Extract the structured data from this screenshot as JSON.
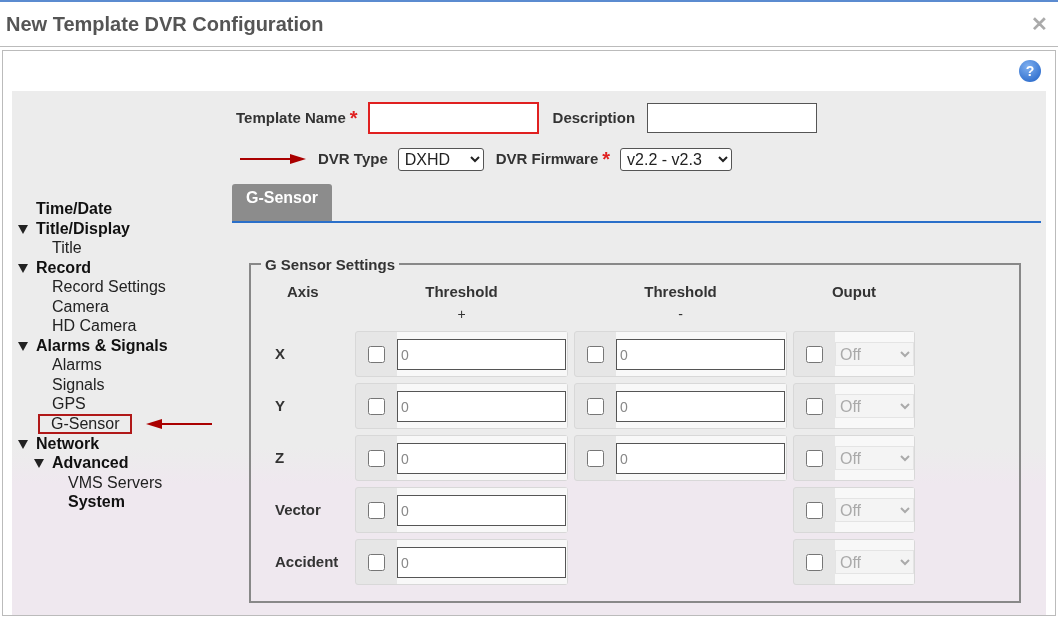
{
  "window": {
    "title": "New Template DVR Configuration",
    "close": "✕",
    "help": "?"
  },
  "form": {
    "template_name": {
      "label": "Template Name",
      "required": "*"
    },
    "description": {
      "label": "Description"
    },
    "dvr_type": {
      "label": "DVR Type",
      "value": "DXHD"
    },
    "dvr_firmware": {
      "label": "DVR Firmware",
      "required": "*",
      "value": "v2.2 - v2.3"
    }
  },
  "sidebar": {
    "items": [
      {
        "label": "Time/Date",
        "kind": "group",
        "selected": false
      },
      {
        "label": "Title/Display",
        "kind": "group",
        "expanded": true,
        "selected": false,
        "children": [
          {
            "label": "Title",
            "kind": "item",
            "selected": false
          }
        ]
      },
      {
        "label": "Record",
        "kind": "group",
        "expanded": true,
        "selected": false,
        "children": [
          {
            "label": "Record Settings",
            "kind": "item",
            "selected": false
          },
          {
            "label": "Camera",
            "kind": "item",
            "selected": false
          },
          {
            "label": "HD Camera",
            "kind": "item",
            "selected": false
          }
        ]
      },
      {
        "label": "Alarms & Signals",
        "kind": "group",
        "expanded": true,
        "selected": false,
        "children": [
          {
            "label": "Alarms",
            "kind": "item",
            "selected": false
          },
          {
            "label": "Signals",
            "kind": "item",
            "selected": false
          },
          {
            "label": "GPS",
            "kind": "item",
            "selected": false
          },
          {
            "label": "G-Sensor",
            "kind": "item",
            "selected": true
          }
        ]
      },
      {
        "label": "Network",
        "kind": "group",
        "expanded": true,
        "selected": false,
        "children": [
          {
            "label": "Advanced",
            "kind": "group",
            "expanded": true,
            "selected": false,
            "children": [
              {
                "label": "VMS Servers",
                "kind": "item",
                "selected": false
              },
              {
                "label": "System",
                "kind": "group",
                "selected": false
              }
            ]
          }
        ]
      }
    ]
  },
  "tabs": [
    {
      "label": "G-Sensor",
      "selected": true
    }
  ],
  "fieldset": {
    "legend": "G Sensor Settings",
    "columns": [
      {
        "label": "Axis"
      },
      {
        "label": "Threshold",
        "sub": "+"
      },
      {
        "label": "Threshold",
        "sub": "-"
      },
      {
        "label": "Ouput"
      }
    ],
    "rows": [
      {
        "axis": "X",
        "plus": {
          "checked": false,
          "placeholder": "0"
        },
        "minus": {
          "checked": false,
          "placeholder": "0"
        },
        "output": {
          "checked": false,
          "value": "Off",
          "disabled": true
        }
      },
      {
        "axis": "Y",
        "plus": {
          "checked": false,
          "placeholder": "0"
        },
        "minus": {
          "checked": false,
          "placeholder": "0"
        },
        "output": {
          "checked": false,
          "value": "Off",
          "disabled": true
        }
      },
      {
        "axis": "Z",
        "plus": {
          "checked": false,
          "placeholder": "0"
        },
        "minus": {
          "checked": false,
          "placeholder": "0"
        },
        "output": {
          "checked": false,
          "value": "Off",
          "disabled": true
        }
      },
      {
        "axis": "Vector",
        "plus": {
          "checked": false,
          "placeholder": "0"
        },
        "output": {
          "checked": false,
          "value": "Off",
          "disabled": true
        }
      },
      {
        "axis": "Accident",
        "plus": {
          "checked": false,
          "placeholder": "0"
        },
        "output": {
          "checked": false,
          "value": "Off",
          "disabled": true
        }
      }
    ]
  }
}
